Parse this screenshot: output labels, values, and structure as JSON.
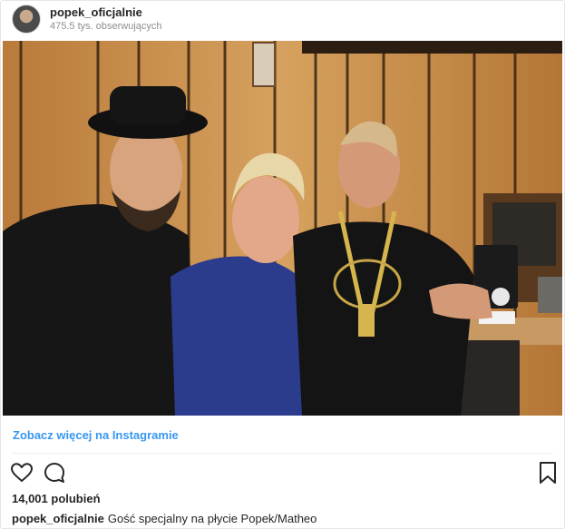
{
  "header": {
    "username": "popek_oficjalnie",
    "followers": "475.5 tys. obserwujących"
  },
  "post": {
    "see_more_link": "Zobacz więcej na Instagramie",
    "likes": "14,001 polubień",
    "caption_user": "popek_oficjalnie",
    "caption_text": "Gość specjalny na płycie Popek/Matheo"
  },
  "icons": [
    "heart-icon",
    "comment-icon",
    "bookmark-icon"
  ],
  "colors": {
    "link": "#3897f0",
    "text": "#262626",
    "secondary": "#8e8e8e",
    "border": "#e6e6e6"
  }
}
